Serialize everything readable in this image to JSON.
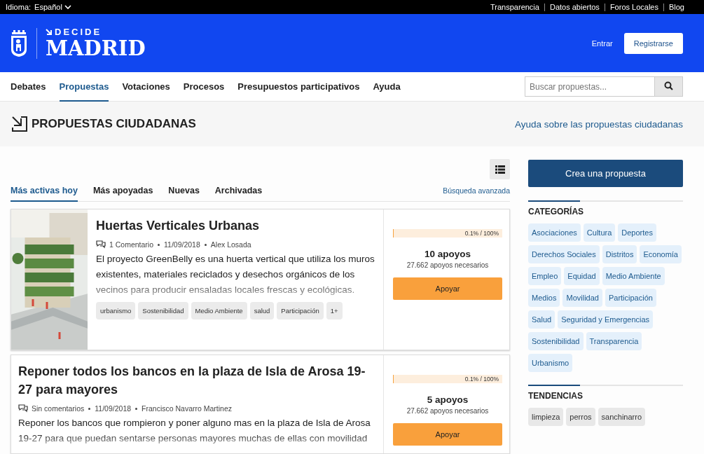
{
  "top_bar": {
    "language_label": "Idioma:",
    "language_value": "Español",
    "links": [
      "Transparencia",
      "Datos abiertos",
      "Foros Locales",
      "Blog"
    ]
  },
  "header": {
    "logo_small": "DECIDE",
    "logo_big": "MADRID",
    "login": "Entrar",
    "register": "Registrarse"
  },
  "nav": {
    "items": [
      {
        "label": "Debates",
        "selected": false
      },
      {
        "label": "Propuestas",
        "selected": true
      },
      {
        "label": "Votaciones",
        "selected": false
      },
      {
        "label": "Procesos",
        "selected": false
      },
      {
        "label": "Presupuestos participativos",
        "selected": false
      },
      {
        "label": "Ayuda",
        "selected": false
      }
    ],
    "search_placeholder": "Buscar propuestas..."
  },
  "page_title": {
    "title": "PROPUESTAS CIUDADANAS",
    "help_link": "Ayuda sobre las propuestas ciudadanas"
  },
  "tabs": [
    {
      "label": "Más activas hoy",
      "selected": true
    },
    {
      "label": "Más apoyadas",
      "selected": false
    },
    {
      "label": "Nuevas",
      "selected": false
    },
    {
      "label": "Archivadas",
      "selected": false
    }
  ],
  "advanced_search": "Búsqueda avanzada",
  "proposals": [
    {
      "kind": "with_image",
      "title": "Huertas Verticales Urbanas",
      "comments": "1 Comentario",
      "date": "11/09/2018",
      "author": "Alex Losada",
      "description": "El proyecto GreenBelly es una huerta vertical que utiliza los muros existentes, materiales reciclados y desechos orgánicos de los vecinos para producir ensaladas locales frescas y ecológicas.",
      "tags": [
        "urbanismo",
        "Sostenibilidad",
        "Medio Ambiente",
        "salud",
        "Participación",
        "1+"
      ],
      "progress": {
        "level": 0.001,
        "reading": "0.1% / 100%"
      },
      "supports": "10 apoyos",
      "needed": "27.662 apoyos necesarios",
      "button": "Apoyar"
    },
    {
      "kind": "text_only",
      "title": "Reponer todos los bancos en la plaza de Isla de Arosa 19-27 para mayores",
      "comments": "Sin comentarios",
      "date": "11/09/2018",
      "author": "Francisco Navarro Martinez",
      "description": "Reponer los bancos que rompieron y poner alguno mas en la plaza de Isla de Arosa 19-27 para que puedan sentarse personas mayores muchas de ellas con movilidad",
      "progress": {
        "level": 0.001,
        "reading": "0.1% / 100%"
      },
      "supports": "5 apoyos",
      "needed": "27.662 apoyos necesarios",
      "button": "Apoyar"
    }
  ],
  "sidebar": {
    "create_button": "Crea una propuesta",
    "categories_title": "CATEGORÍAS",
    "categories": [
      "Asociaciones",
      "Cultura",
      "Deportes",
      "Derechos Sociales",
      "Distritos",
      "Economía",
      "Empleo",
      "Equidad",
      "Medio Ambiente",
      "Medios",
      "Movilidad",
      "Participación",
      "Salud",
      "Seguridad y Emergencias",
      "Sostenibilidad",
      "Transparencia",
      "Urbanismo"
    ],
    "trends_title": "TENDENCIAS",
    "trends": [
      "limpieza",
      "perros",
      "sanchinarro"
    ]
  }
}
